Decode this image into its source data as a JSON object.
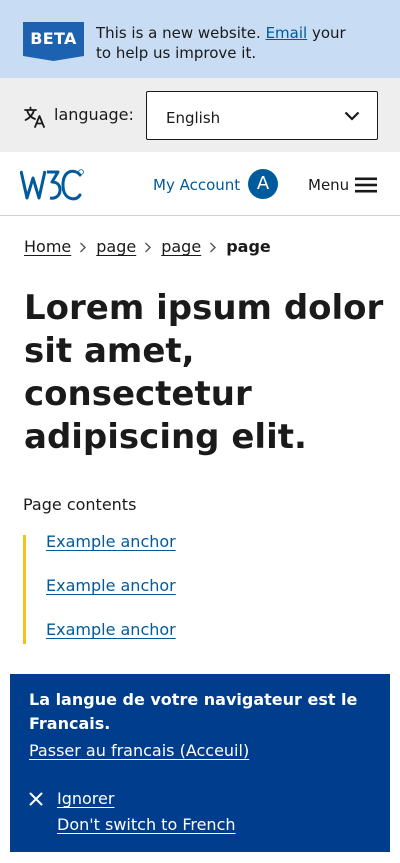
{
  "beta_banner": {
    "tag": "BETA",
    "text_before": "This is a new website.",
    "link": "Email",
    "text_after_link": "your",
    "text_line2": "to help us improve it."
  },
  "language_bar": {
    "label": "language:",
    "selected": "English",
    "icon": "translate-icon"
  },
  "header": {
    "logo": "W3C",
    "account_link": "My Account",
    "avatar_initial": "A",
    "menu_label": "Menu"
  },
  "breadcrumb": {
    "items": [
      "Home",
      "page",
      "page"
    ],
    "current": "page"
  },
  "page": {
    "title": "Lorem ipsum dolor sit amet, consectetur adipiscing elit."
  },
  "toc": {
    "heading": "Page contents",
    "items": [
      "Example anchor",
      "Example anchor",
      "Example anchor"
    ]
  },
  "language_notice": {
    "heading": "La langue de votre navigateur est le Francais.",
    "switch_link": "Passer au francais (Acceuil)",
    "ignore_link": "Ignorer",
    "dont_switch_link": "Don't switch to French"
  },
  "colors": {
    "banner_bg": "#c8dcf4",
    "brand_blue": "#005a9c",
    "tag_blue": "#1d62b0",
    "notice_bg": "#003d8c",
    "toc_accent": "#f2c318",
    "lang_bar_bg": "#eeeeee"
  }
}
